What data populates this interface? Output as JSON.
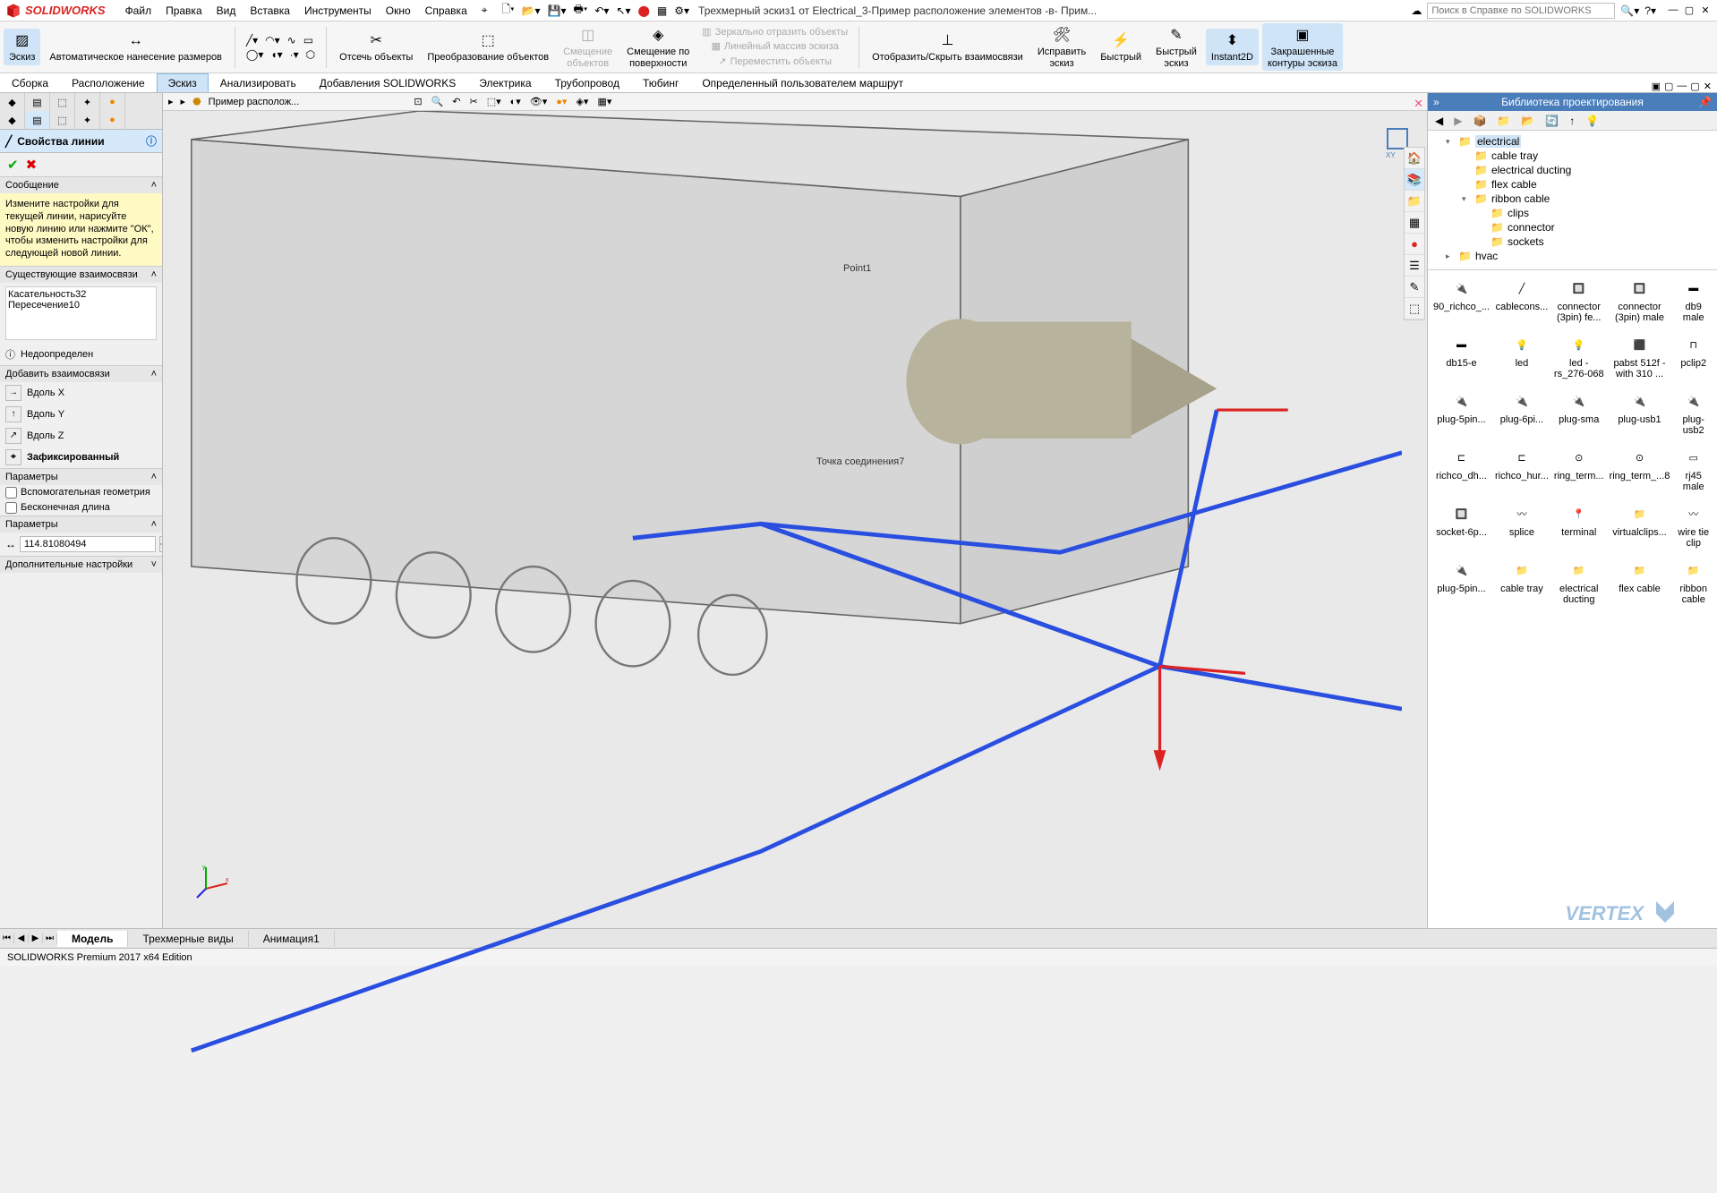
{
  "app": {
    "logo_text": "SOLIDWORKS",
    "doc_title": "Трехмерный эскиз1 от Electrical_3-Пример расположение элементов -в- Прим...",
    "search_placeholder": "Поиск в Справке по SOLIDWORKS",
    "status": "SOLIDWORKS Premium 2017 x64 Edition"
  },
  "menus": [
    "Файл",
    "Правка",
    "Вид",
    "Вставка",
    "Инструменты",
    "Окно",
    "Справка"
  ],
  "ribbon": {
    "buttons": [
      {
        "label": "Эскиз",
        "hl": true
      },
      {
        "label": "Автоматическое нанесение размеров"
      },
      {
        "label": "Отсечь объекты"
      },
      {
        "label": "Преобразование объектов"
      },
      {
        "label": "Смещение\nобъектов",
        "disabled": true
      },
      {
        "label": "Смещение по\nповерхности"
      },
      {
        "label": "Зеркально отразить объекты",
        "disabled": true
      },
      {
        "label": "Линейный массив эскиза",
        "disabled": true
      },
      {
        "label": "Переместить объекты",
        "disabled": true
      },
      {
        "label": "Отобразить/Скрыть взаимосвязи"
      },
      {
        "label": "Исправить\nэскиз"
      },
      {
        "label": "Быстрый\n"
      },
      {
        "label": "Быстрый\nэскиз"
      },
      {
        "label": "Instant2D",
        "hl": true
      },
      {
        "label": "Закрашенные\nконтуры эскиза",
        "hl": true
      }
    ]
  },
  "ribbon_tabs": [
    "Сборка",
    "Расположение",
    "Эскиз",
    "Анализировать",
    "Добавления SOLIDWORKS",
    "Электрика",
    "Трубопровод",
    "Тюбинг",
    "Определенный пользователем маршрут"
  ],
  "ribbon_tabs_active": 2,
  "left": {
    "title": "Свойства линии",
    "section_msg": "Сообщение",
    "message": "Измените настройки для текущей линии, нарисуйте новую линию или нажмите \"ОК\", чтобы изменить настройки для следующей новой линии.",
    "section_existing": "Существующие взаимосвязи",
    "existing": [
      "Касательность32",
      "Пересечение10"
    ],
    "info_status": "Недоопределен",
    "section_add": "Добавить взаимосвязи",
    "rel_x": "Вдоль X",
    "rel_y": "Вдоль Y",
    "rel_z": "Вдоль Z",
    "rel_fixed": "Зафиксированный",
    "section_params": "Параметры",
    "aux_geom": "Вспомогательная геометрия",
    "infinite": "Бесконечная длина",
    "section_params2": "Параметры",
    "length_value": "114.81080494",
    "section_additional": "Дополнительные настройки"
  },
  "viewport": {
    "crumb": "Пример располож...",
    "anno_point1": "Point1",
    "anno_cpoint7": "Точка соединения7"
  },
  "right": {
    "title": "Библиотека проектирования",
    "tree": [
      {
        "label": "electrical",
        "indent": 1,
        "exp": "▾",
        "selected": true
      },
      {
        "label": "cable tray",
        "indent": 2
      },
      {
        "label": "electrical ducting",
        "indent": 2
      },
      {
        "label": "flex cable",
        "indent": 2
      },
      {
        "label": "ribbon cable",
        "indent": 2,
        "exp": "▾"
      },
      {
        "label": "clips",
        "indent": 3
      },
      {
        "label": "connector",
        "indent": 3
      },
      {
        "label": "sockets",
        "indent": 3
      },
      {
        "label": "hvac",
        "indent": 1,
        "exp": "▸"
      }
    ],
    "items": [
      "90_richco_...",
      "cablecons...",
      "connector (3pin) fe...",
      "connector (3pin) male",
      "db9 male",
      "db15-e",
      "led",
      "led - rs_276-068",
      "pabst 512f - with 310 ...",
      "pclip2",
      "plug-5pin...",
      "plug-6pi...",
      "plug-sma",
      "plug-usb1",
      "plug-usb2",
      "richco_dh...",
      "richco_hur...",
      "ring_term...",
      "ring_term_...8",
      "rj45 male",
      "socket-6p...",
      "splice",
      "terminal",
      "virtualclips...",
      "wire tie clip",
      "plug-5pin...",
      "cable tray",
      "electrical ducting",
      "flex cable",
      "ribbon cable"
    ],
    "logo": "VERTEX"
  },
  "bottom_tabs": [
    "Модель",
    "Трехмерные виды",
    "Анимация1"
  ],
  "bottom_tabs_active": 0
}
